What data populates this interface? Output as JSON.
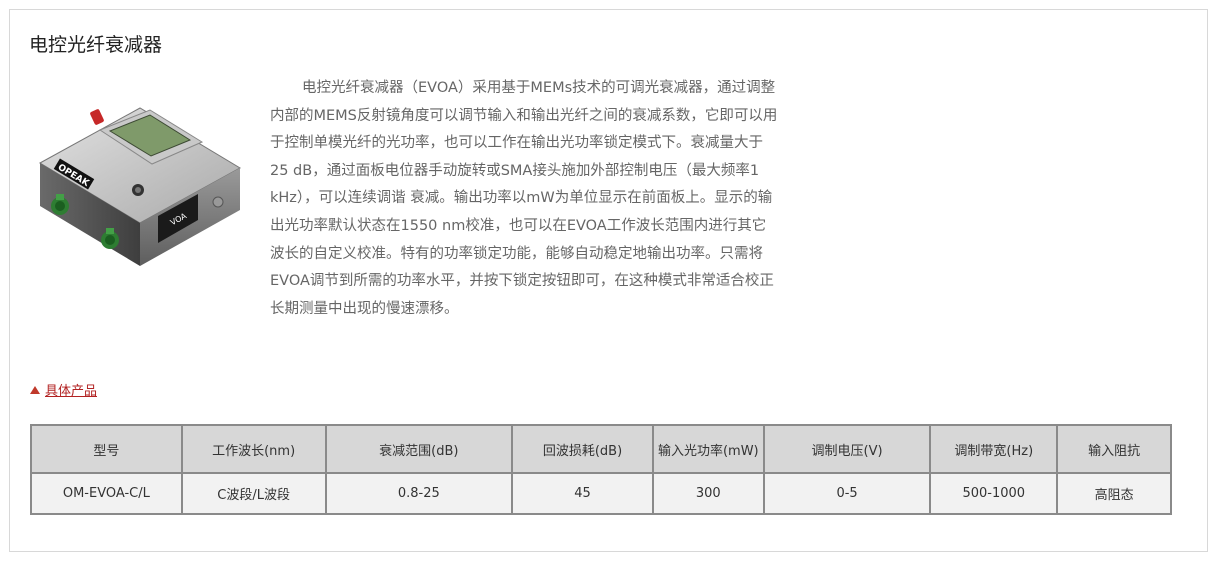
{
  "section": {
    "title": "电控光纤衰减器",
    "description": "电控光纤衰减器（EVOA）采用基于MEMs技术的可调光衰减器，通过调整内部的MEMS反射镜角度可以调节输入和输出光纤之间的衰减系数，它即可以用于控制单模光纤的光功率，也可以工作在输出光功率锁定模式下。衰减量大于25 dB，通过面板电位器手动旋转或SMA接头施加外部控制电压（最大频率1 kHz），可以连续调谐 衰减。输出功率以mW为单位显示在前面板上。显示的输出光功率默认状态在1550 nm校准，也可以在EVOA工作波长范围内进行其它波长的自定义校准。特有的功率锁定功能，能够自动稳定地输出功率。只需将EVOA调节到所需的功率水平，并按下锁定按钮即可，在这种模式非常适合校正长期测量中出现的慢速漂移。",
    "product_link": "具体产品",
    "device": {
      "brand_label": "OPEAK",
      "side_label": "VOA"
    }
  },
  "table": {
    "headers": [
      "型号",
      "工作波长(nm)",
      "衰减范围(dB)",
      "回波损耗(dB)",
      "输入光功率(mW)",
      "调制电压(V)",
      "调制带宽(Hz)",
      "输入阻抗"
    ],
    "rows": [
      [
        "OM-EVOA-C/L",
        "C波段/L波段",
        "0.8-25",
        "45",
        "300",
        "0-5",
        "500-1000",
        "高阻态"
      ]
    ]
  },
  "colors": {
    "link": "#b22222",
    "header_bg": "#d7d7d7",
    "row_bg": "#f2f2f2",
    "border": "#8a8a8a"
  }
}
